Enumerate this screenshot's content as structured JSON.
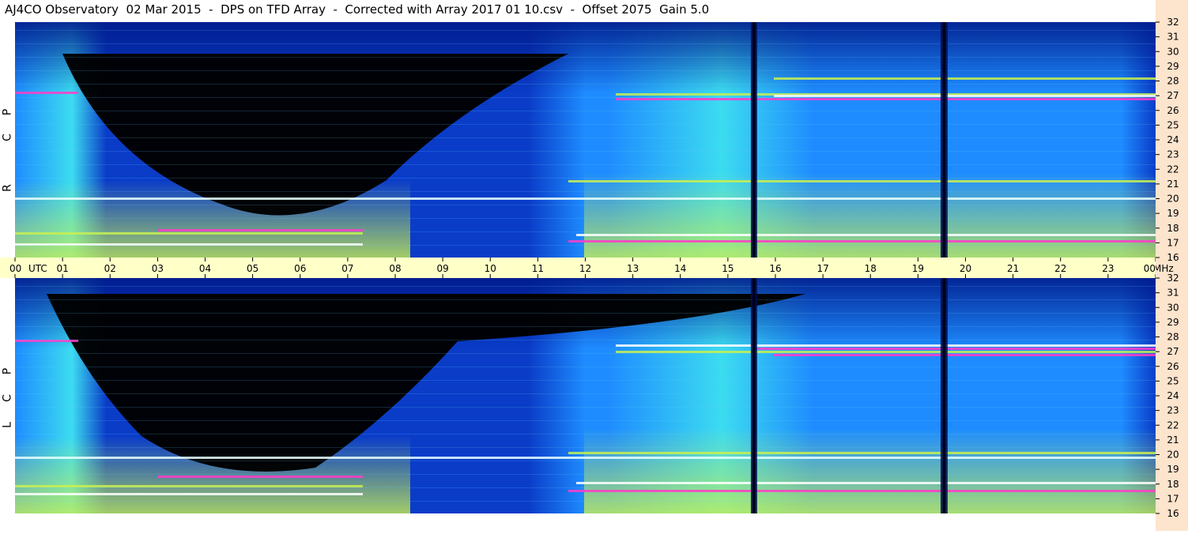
{
  "title": "AJ4CO Observatory  02 Mar 2015  -  DPS on TFD Array  -  Corrected with Array 2017 01 10.csv  -  Offset 2075  Gain 5.0",
  "chart_data": {
    "type": "heatmap",
    "title": "AJ4CO Observatory  02 Mar 2015  -  DPS on TFD Array  -  Corrected with Array 2017 01 10.csv  -  Offset 2075  Gain 5.0",
    "x_unit_label": "UTC",
    "y_unit_label": "MHz",
    "x_ticks": [
      "00",
      "01",
      "02",
      "03",
      "04",
      "05",
      "06",
      "07",
      "08",
      "09",
      "10",
      "11",
      "12",
      "13",
      "14",
      "15",
      "16",
      "17",
      "18",
      "19",
      "20",
      "21",
      "22",
      "23",
      "00"
    ],
    "xlim": [
      0,
      24
    ],
    "y_ticks": [
      16,
      17,
      18,
      19,
      20,
      21,
      22,
      23,
      24,
      25,
      26,
      27,
      28,
      29,
      30,
      31,
      32
    ],
    "ylim": [
      16,
      32
    ],
    "panels": [
      {
        "name": "RCP",
        "letters": [
          "R",
          "C",
          "P"
        ]
      },
      {
        "name": "LCP",
        "letters": [
          "L",
          "C",
          "P"
        ]
      }
    ],
    "colors": {
      "low": "#000000",
      "mid_low": "#0a3cc8",
      "mid": "#1e8cff",
      "mid_high": "#3cdcf0",
      "high": "#c8f050",
      "very_high": "#ff3cc8",
      "max": "#ffffff"
    },
    "grid": false
  }
}
